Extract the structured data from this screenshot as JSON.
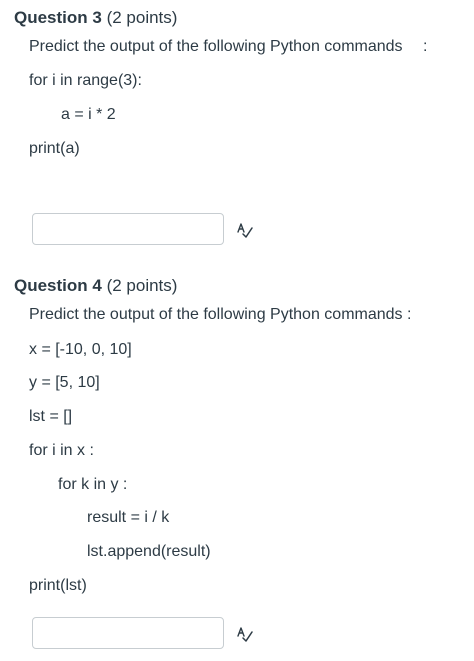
{
  "question3": {
    "number": "Question 3",
    "points": " (2 points)",
    "prompt": "Predict the output of the following Python commands",
    "prompt_suffix": ":",
    "code": [
      "for i in range(3):",
      "a = i * 2",
      "print(a)"
    ],
    "answer_value": "",
    "spellcheck_icon": "spellcheck-icon"
  },
  "question4": {
    "number": "Question 4",
    "points": " (2 points)",
    "prompt": "Predict the output of the following Python commands :",
    "code": [
      "x = [-10, 0, 10]",
      "y = [5, 10]",
      "lst = []",
      "for i in x :",
      "for k in y :",
      "result  =  i / k",
      "lst.append(result)",
      "print(lst)"
    ],
    "answer_value": "",
    "spellcheck_icon": "spellcheck-icon"
  }
}
